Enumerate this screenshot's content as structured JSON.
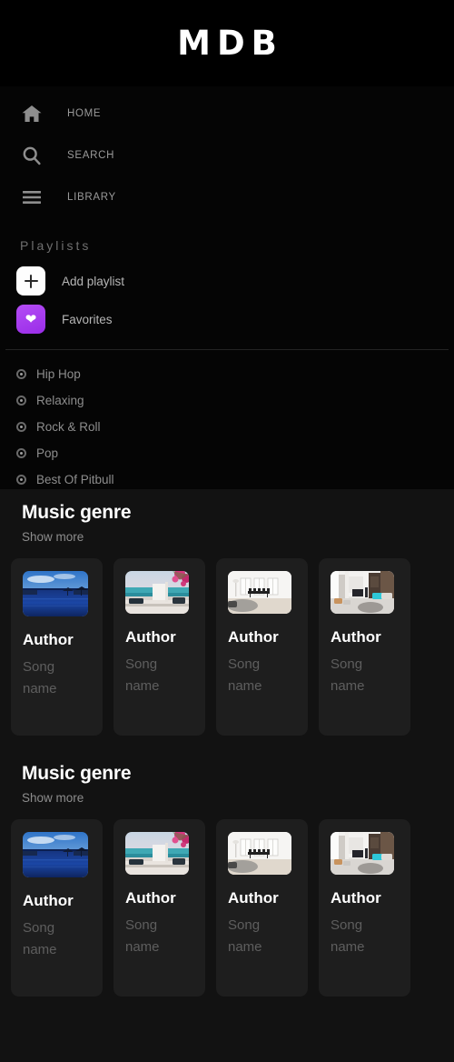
{
  "brand": {
    "title": "MDB"
  },
  "nav": {
    "items": [
      {
        "label": "HOME",
        "icon": "home-icon"
      },
      {
        "label": "SEARCH",
        "icon": "search-icon"
      },
      {
        "label": "LIBRARY",
        "icon": "hamburger-icon"
      }
    ]
  },
  "playlists": {
    "section_label": "Playlists",
    "actions": [
      {
        "label": "Add playlist",
        "icon": "plus-icon",
        "tile_color": "#fdfdfd"
      },
      {
        "label": "Favorites",
        "icon": "heart-icon",
        "tile_color": "#a73df0"
      }
    ],
    "genres": [
      {
        "label": "Hip Hop"
      },
      {
        "label": "Relaxing"
      },
      {
        "label": "Rock & Roll"
      },
      {
        "label": "Pop"
      },
      {
        "label": "Best Of Pitbull"
      }
    ]
  },
  "content": {
    "sections": [
      {
        "title": "Music genre",
        "show_more": "Show more",
        "cards": [
          {
            "author": "Author",
            "song": "Song name",
            "thumb": "infinity-pool-thumbnail"
          },
          {
            "author": "Author",
            "song": "Song name",
            "thumb": "seaside-terrace-thumbnail"
          },
          {
            "author": "Author",
            "song": "Song name",
            "thumb": "white-dining-room-thumbnail"
          },
          {
            "author": "Author",
            "song": "Song name",
            "thumb": "modern-living-room-thumbnail"
          }
        ]
      },
      {
        "title": "Music genre",
        "show_more": "Show more",
        "cards": [
          {
            "author": "Author",
            "song": "Song name",
            "thumb": "infinity-pool-thumbnail"
          },
          {
            "author": "Author",
            "song": "Song name",
            "thumb": "seaside-terrace-thumbnail"
          },
          {
            "author": "Author",
            "song": "Song name",
            "thumb": "white-dining-room-thumbnail"
          },
          {
            "author": "Author",
            "song": "Song name",
            "thumb": "modern-living-room-thumbnail"
          }
        ]
      }
    ]
  },
  "colors": {
    "background": "#0a0a0a",
    "sidebar": "#050505",
    "main": "#121212",
    "card": "#1e1e1e",
    "accent_purple": "#a73df0",
    "text_primary": "#ffffff",
    "text_muted": "#8d8d8d",
    "text_dim": "#5e5e5e"
  }
}
